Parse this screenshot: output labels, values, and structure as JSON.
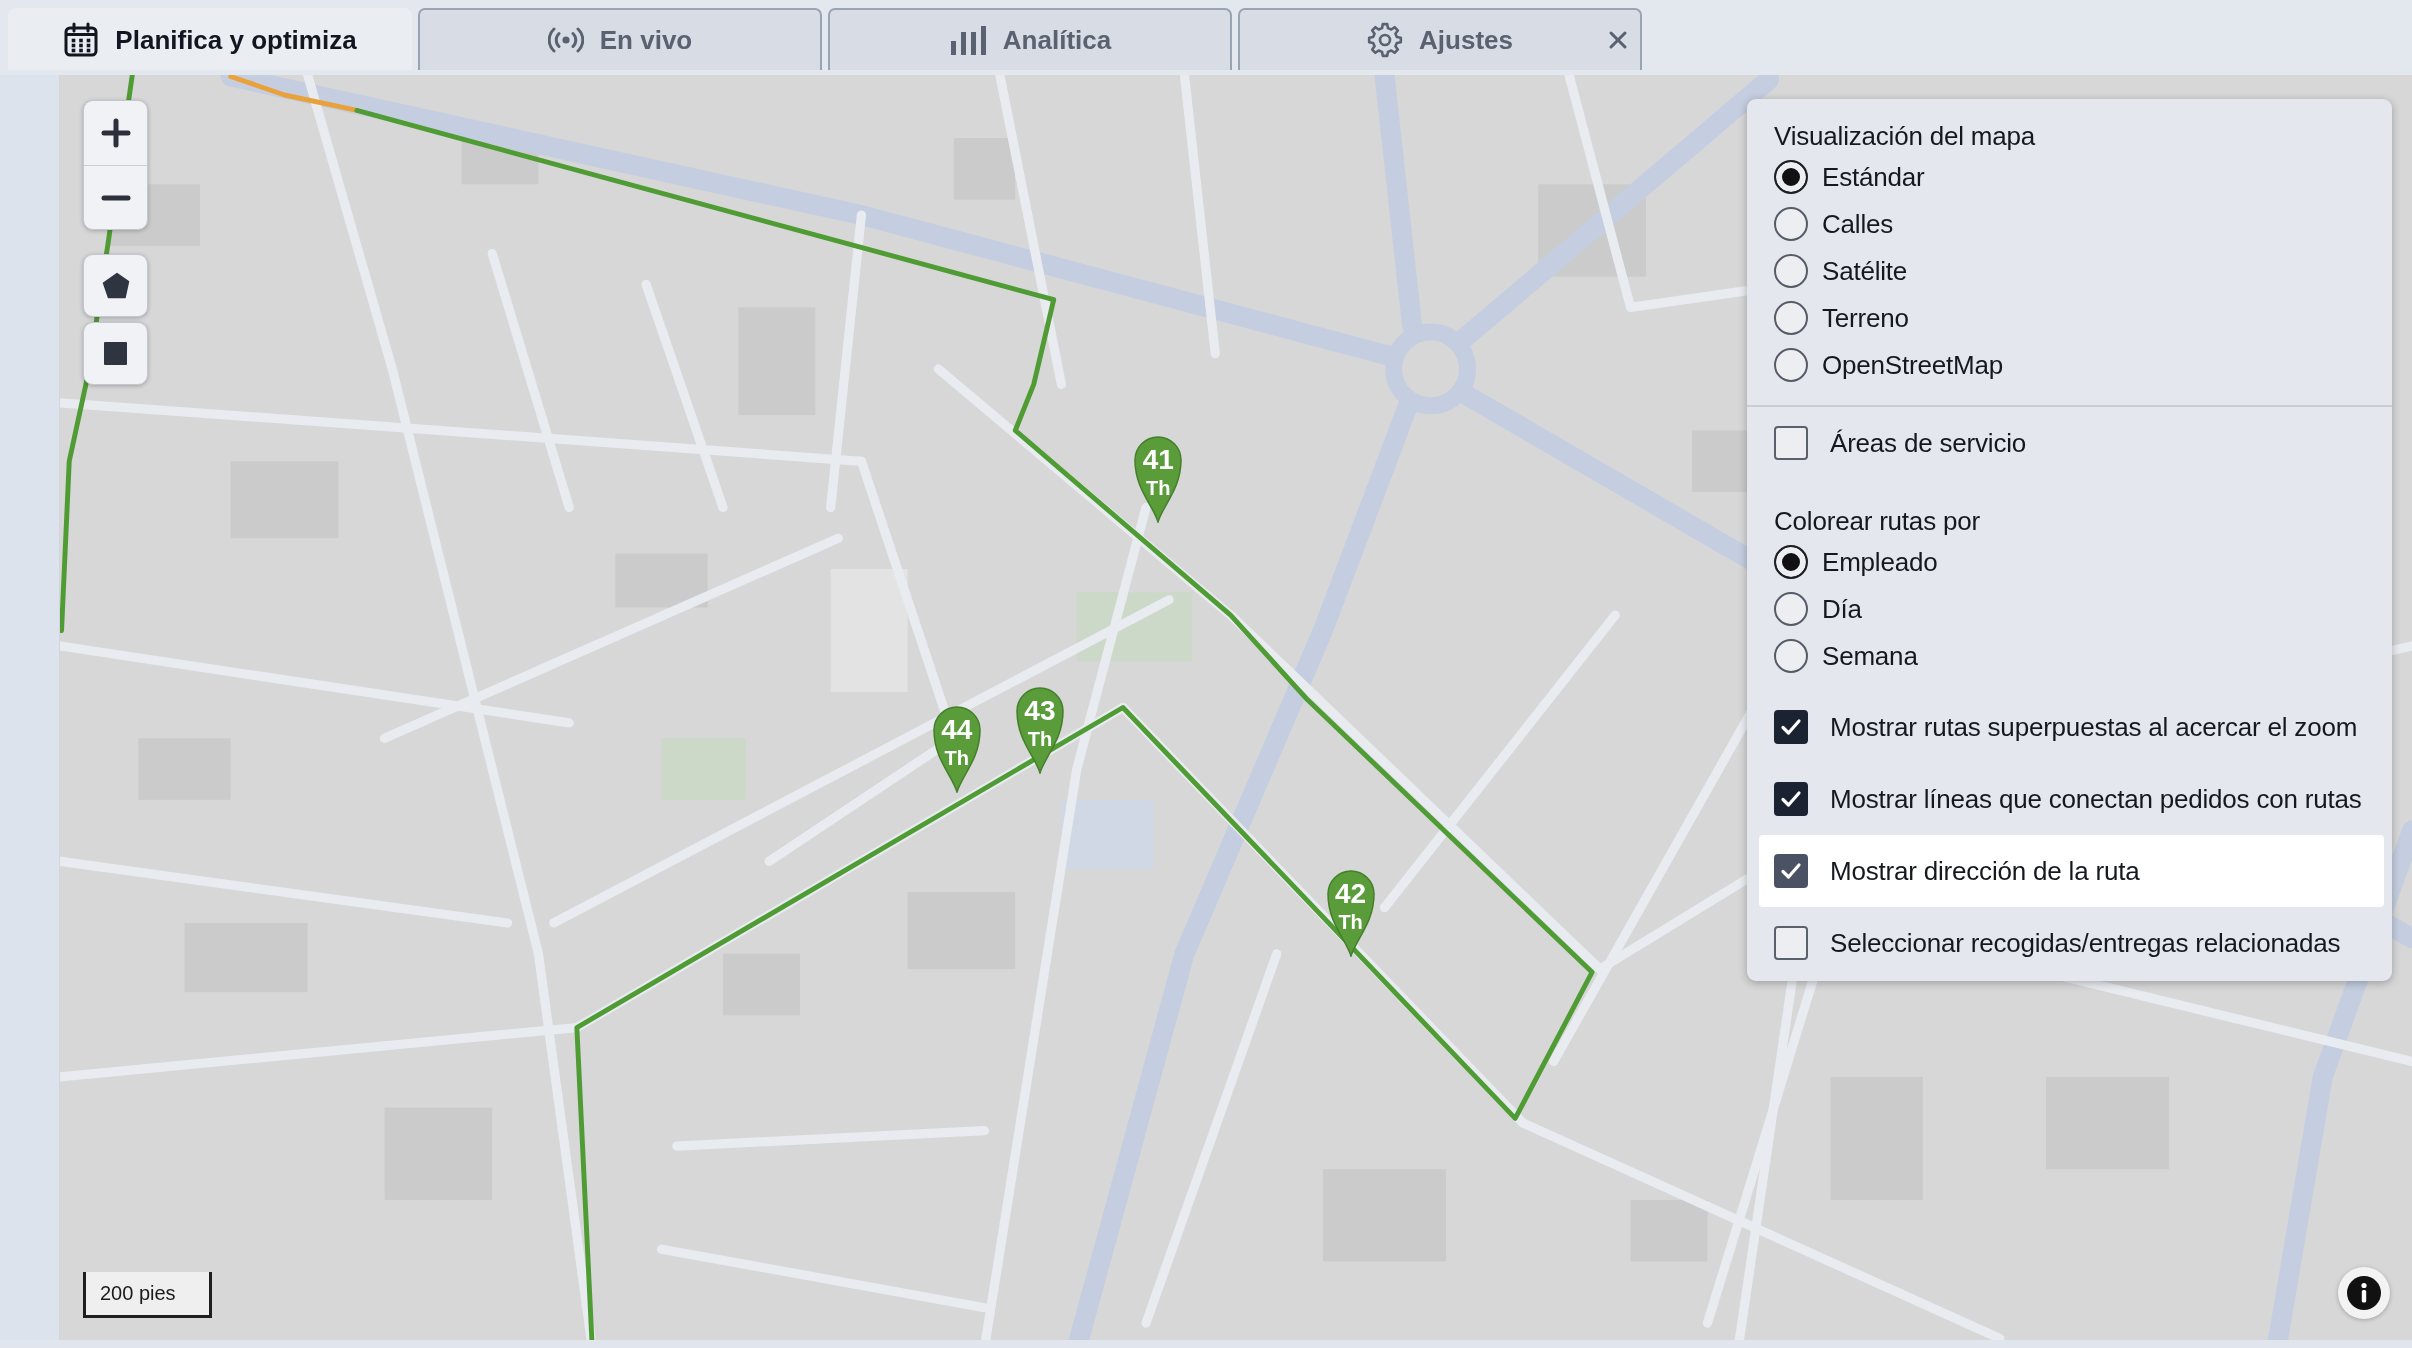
{
  "tabs": [
    {
      "label": "Planifica y optimiza",
      "selected": true,
      "closable": false
    },
    {
      "label": "En vivo",
      "selected": false,
      "closable": false
    },
    {
      "label": "Analítica",
      "selected": false,
      "closable": false
    },
    {
      "label": "Ajustes",
      "selected": false,
      "closable": true
    }
  ],
  "map": {
    "stops": [
      {
        "number": "41",
        "label": "Th"
      },
      {
        "number": "43",
        "label": "Th"
      },
      {
        "number": "44",
        "label": "Th"
      },
      {
        "number": "42",
        "label": "Th"
      }
    ],
    "scale_bar": "200 pies"
  },
  "map_options": {
    "sections": [
      {
        "kind": "radio",
        "title": "Visualización del mapa",
        "options": [
          {
            "label": "Estándar",
            "selected": true
          },
          {
            "label": "Calles",
            "selected": false
          },
          {
            "label": "Satélite",
            "selected": false
          },
          {
            "label": "Terreno",
            "selected": false
          },
          {
            "label": "OpenStreetMap",
            "selected": false
          }
        ]
      },
      {
        "kind": "checkbox",
        "options": [
          {
            "label": "Áreas de servicio",
            "checked": false,
            "highlighted": false
          }
        ]
      },
      {
        "kind": "radio",
        "title": "Colorear rutas por",
        "options": [
          {
            "label": "Empleado",
            "selected": true
          },
          {
            "label": "Día",
            "selected": false
          },
          {
            "label": "Semana",
            "selected": false
          }
        ]
      },
      {
        "kind": "checkbox",
        "options": [
          {
            "label": "Mostrar rutas superpuestas al acercar el zoom",
            "checked": true,
            "highlighted": false
          },
          {
            "label": "Mostrar líneas que conectan pedidos con rutas",
            "checked": true,
            "highlighted": false
          },
          {
            "label": "Mostrar dirección de la ruta",
            "checked": true,
            "highlighted": true
          },
          {
            "label": "Seleccionar recogidas/entregas relacionadas",
            "checked": false,
            "highlighted": false
          }
        ]
      }
    ]
  }
}
